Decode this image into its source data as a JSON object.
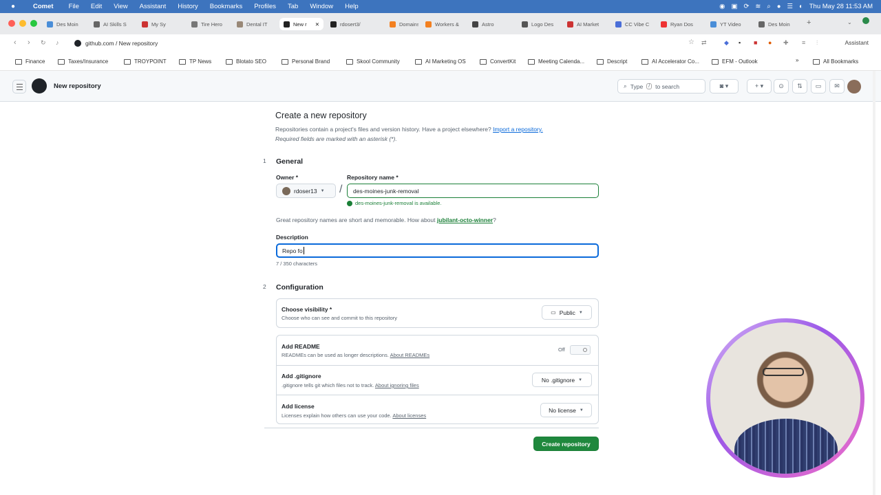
{
  "menubar": {
    "app": "Comet",
    "items": [
      "File",
      "Edit",
      "View",
      "Assistant",
      "History",
      "Bookmarks",
      "Profiles",
      "Tab",
      "Window",
      "Help"
    ],
    "datetime": "Thu May 28  11:53 AM"
  },
  "tabs": [
    {
      "label": "Des Moin",
      "color": "#4a8ed8"
    },
    {
      "label": "AI Skills S",
      "color": "#666"
    },
    {
      "label": "My Sy",
      "color": "#c33"
    },
    {
      "label": "Tire Hero",
      "color": "#777"
    },
    {
      "label": "Dental IT",
      "color": "#987"
    },
    {
      "label": "New r",
      "color": "#222",
      "active": true
    },
    {
      "label": "rdosert3/",
      "color": "#222"
    },
    {
      "label": "Domains",
      "color": "#f38020"
    },
    {
      "label": "Workers &",
      "color": "#f38020"
    },
    {
      "label": "Astro",
      "color": "#444"
    },
    {
      "label": "Logo Des",
      "color": "#555"
    },
    {
      "label": "AI Market",
      "color": "#c33"
    },
    {
      "label": "CC Vibe C",
      "color": "#4a6ed8"
    },
    {
      "label": "Ryan Dos",
      "color": "#e33"
    },
    {
      "label": "YT Video",
      "color": "#4a8ed8"
    },
    {
      "label": "Des Moin",
      "color": "#666"
    }
  ],
  "address": {
    "url": "github.com / New repository",
    "assistant": "Assistant"
  },
  "bookmarks": [
    "Finance",
    "Taxes/Insurance",
    "TROYPOINT",
    "TP News",
    "Blotato SEO",
    "Personal Brand",
    "Skool Community",
    "AI Marketing OS",
    "ConvertKit",
    "Meeting Calenda...",
    "Descript",
    "AI Accelerator Co...",
    "EFM - Outlook",
    "All Bookmarks"
  ],
  "header": {
    "title": "New repository",
    "search_placeholder": "Type",
    "search_key": "/",
    "search_suffix": "to search"
  },
  "page": {
    "title": "Create a new repository",
    "subtitle": "Repositories contain a project's files and version history. Have a project elsewhere?",
    "import_link": "Import a repository.",
    "required_note": "Required fields are marked with an asterisk (*)."
  },
  "general": {
    "step": "1",
    "heading": "General",
    "owner_label": "Owner *",
    "owner_value": "rdoser13",
    "name_label": "Repository name *",
    "name_value": "des-moines-junk-removal",
    "available": "des-moines-junk-removal is available.",
    "hint_prefix": "Great repository names are short and memorable. How about",
    "hint_suggestion": "jubilant-octo-winner",
    "hint_suffix": "?",
    "desc_label": "Description",
    "desc_value": "Repo fo",
    "desc_count": "7 / 350 characters"
  },
  "configuration": {
    "step": "2",
    "heading": "Configuration",
    "visibility_title": "Choose visibility *",
    "visibility_desc": "Choose who can see and commit to this repository",
    "visibility_value": "Public",
    "readme_title": "Add README",
    "readme_desc": "READMEs can be used as longer descriptions.",
    "readme_link": "About READMEs",
    "readme_state": "Off",
    "gitignore_title": "Add .gitignore",
    "gitignore_desc": ".gitignore tells git which files not to track.",
    "gitignore_link": "About ignoring files",
    "gitignore_value": "No .gitignore",
    "license_title": "Add license",
    "license_desc": "Licenses explain how others can use your code.",
    "license_link": "About licenses",
    "license_value": "No license"
  },
  "create_button": "Create repository"
}
